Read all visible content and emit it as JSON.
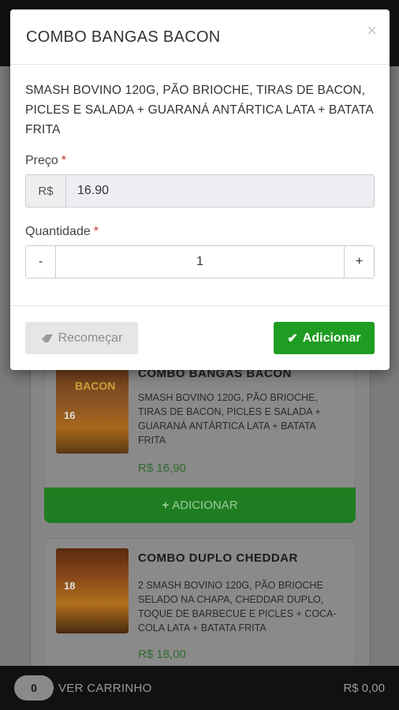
{
  "modal": {
    "title": "COMBO BANGAS BACON",
    "description": "SMASH BOVINO 120G, PÃO BRIOCHE, TIRAS DE BACON, PICLES E SALADA + GUARANÁ ANTÁRTICA LATA + BATATA FRITA",
    "close_icon": "×",
    "price_label": "Preço",
    "required_mark": "*",
    "currency_prefix": "R$",
    "price_value": "16.90",
    "quantity_label": "Quantidade",
    "quantity_minus": "-",
    "quantity_value": "1",
    "quantity_plus": "+",
    "reset_label": "Recomeçar",
    "add_label": "Adicionar",
    "check_icon": "✔"
  },
  "products": [
    {
      "title": "COMBO BANGAS BACON",
      "description": "SMASH BOVINO 120G, PÃO BRIOCHE, TIRAS DE BACON, PICLES E SALADA + GUARANÁ ANTÁRTICA LATA + BATATA FRITA",
      "price": "R$ 16,90",
      "add_label": "ADICIONAR",
      "thumb_title": "BACON",
      "thumb_price": "16"
    },
    {
      "title": "COMBO DUPLO CHEDDAR",
      "description": "2 SMASH BOVINO 120G, PÃO BRIOCHE SELADO NA CHAPA, CHEDDAR DUPLO, TOQUE DE BARBECUE E PICLES + COCA-COLA LATA + BATATA FRITA",
      "price": "R$ 18,00",
      "thumb_price": "18"
    }
  ],
  "cart": {
    "count": "0",
    "label": "VER CARRINHO",
    "total": "R$ 0,00"
  }
}
